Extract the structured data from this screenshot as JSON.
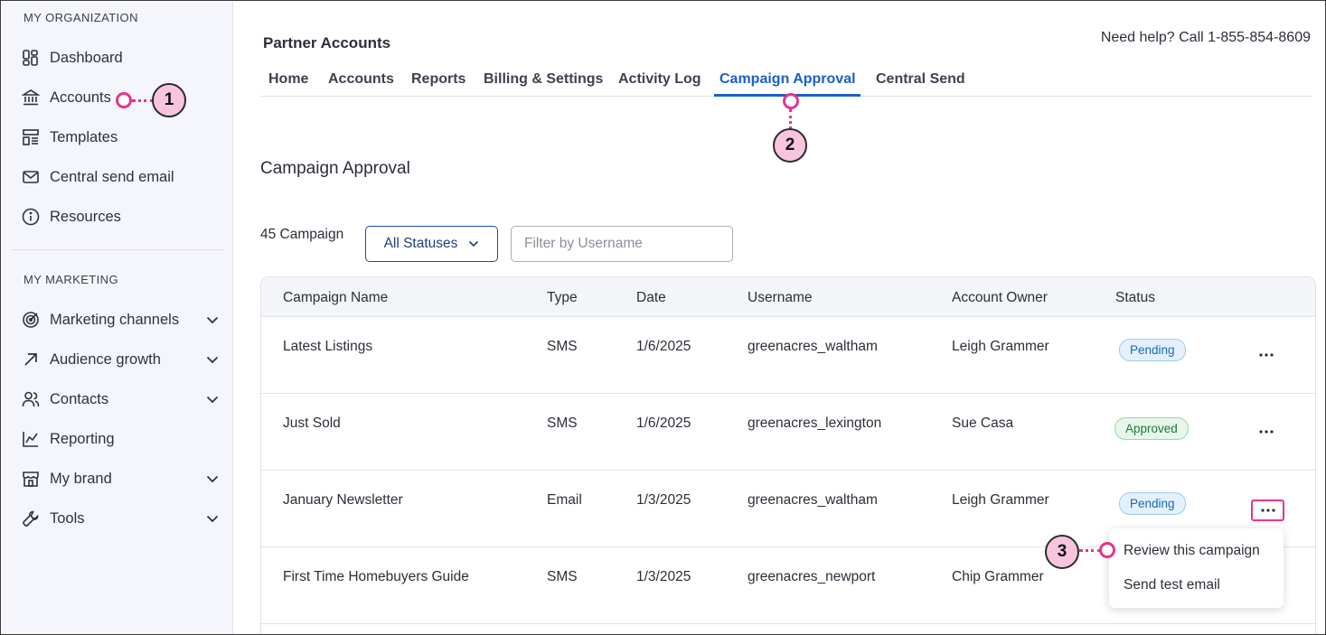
{
  "sidebar": {
    "org_title": "MY ORGANIZATION",
    "org_items": [
      {
        "label": "Dashboard",
        "icon": "dashboard-icon"
      },
      {
        "label": "Accounts",
        "icon": "bank-icon"
      },
      {
        "label": "Templates",
        "icon": "templates-icon"
      },
      {
        "label": "Central send email",
        "icon": "envelope-icon"
      },
      {
        "label": "Resources",
        "icon": "info-icon"
      }
    ],
    "marketing_title": "MY MARKETING",
    "marketing_items": [
      {
        "label": "Marketing channels",
        "icon": "target-icon",
        "expandable": true
      },
      {
        "label": "Audience growth",
        "icon": "arrow-up-right-icon",
        "expandable": true
      },
      {
        "label": "Contacts",
        "icon": "people-icon",
        "expandable": true
      },
      {
        "label": "Reporting",
        "icon": "chart-icon",
        "expandable": false
      },
      {
        "label": "My brand",
        "icon": "storefront-icon",
        "expandable": true
      },
      {
        "label": "Tools",
        "icon": "wrench-icon",
        "expandable": true
      }
    ]
  },
  "header": {
    "title": "Partner Accounts",
    "help": "Need help? Call 1-855-854-8609"
  },
  "tabs": [
    {
      "label": "Home",
      "active": false
    },
    {
      "label": "Accounts",
      "active": false
    },
    {
      "label": "Reports",
      "active": false
    },
    {
      "label": "Billing & Settings",
      "active": false
    },
    {
      "label": "Activity Log",
      "active": false
    },
    {
      "label": "Campaign Approval",
      "active": true
    },
    {
      "label": "Central Send",
      "active": false
    }
  ],
  "main": {
    "title": "Campaign Approval",
    "count": "45 Campaign",
    "status_filter": "All Statuses",
    "username_placeholder": "Filter by Username"
  },
  "table": {
    "columns": [
      "Campaign Name",
      "Type",
      "Date",
      "Username",
      "Account Owner",
      "Status"
    ],
    "rows": [
      {
        "name": "Latest Listings",
        "type": "SMS",
        "date": "1/6/2025",
        "username": "greenacres_waltham",
        "owner": "Leigh Grammer",
        "status": "Pending"
      },
      {
        "name": "Just Sold",
        "type": "SMS",
        "date": "1/6/2025",
        "username": "greenacres_lexington",
        "owner": "Sue Casa",
        "status": "Approved"
      },
      {
        "name": "January Newsletter",
        "type": "Email",
        "date": "1/3/2025",
        "username": "greenacres_waltham",
        "owner": "Leigh Grammer",
        "status": "Pending"
      },
      {
        "name": "First Time Homebuyers Guide",
        "type": "SMS",
        "date": "1/3/2025",
        "username": "greenacres_newport",
        "owner": "Chip Grammer",
        "status": ""
      }
    ]
  },
  "menu": {
    "review": "Review this campaign",
    "send_test": "Send test email"
  },
  "callouts": [
    "1",
    "2",
    "3"
  ],
  "colors": {
    "accent": "#1a5fc8",
    "callout_fill": "#f9c4de",
    "callout_line": "#e8338d",
    "sidebar_bg": "#f5f6fb"
  }
}
